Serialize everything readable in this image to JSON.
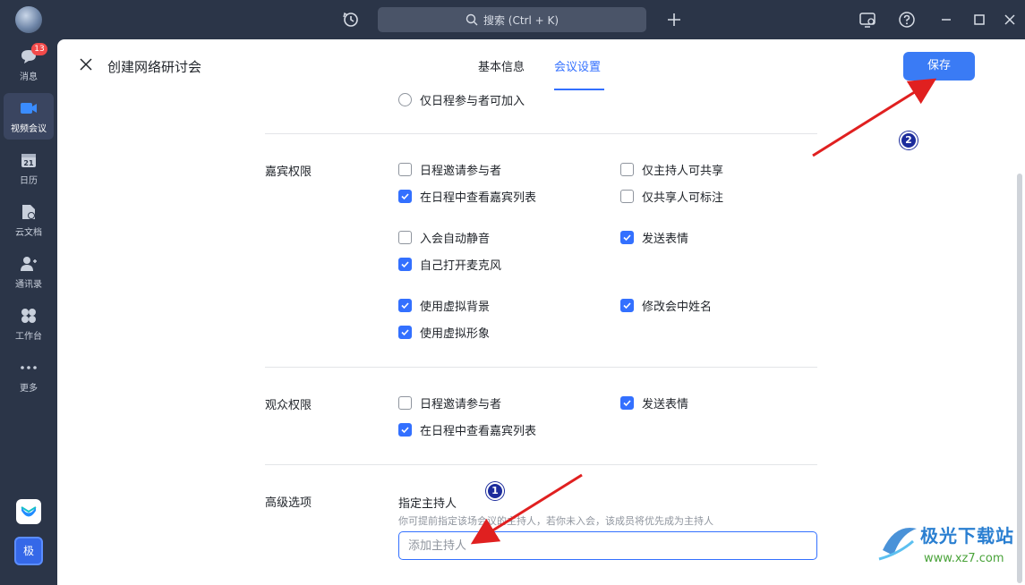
{
  "titlebar": {
    "search_label": "搜索 (Ctrl + K)"
  },
  "sidebar": {
    "items": [
      {
        "label": "消息",
        "icon": "chat-bubble-icon",
        "badge": "13"
      },
      {
        "label": "视频会议",
        "icon": "video-camera-icon"
      },
      {
        "label": "日历",
        "icon": "calendar-icon",
        "icon_text": "21"
      },
      {
        "label": "云文档",
        "icon": "document-icon"
      },
      {
        "label": "通讯录",
        "icon": "contacts-icon"
      },
      {
        "label": "工作台",
        "icon": "grid-icon"
      },
      {
        "label": "更多",
        "icon": "more-dots-icon"
      }
    ],
    "bottom_app_label": "极"
  },
  "panel": {
    "title": "创建网络研讨会",
    "tabs": [
      {
        "label": "基本信息",
        "active": false
      },
      {
        "label": "会议设置",
        "active": true
      }
    ],
    "save_label": "保存",
    "top_radio": "仅日程参与者可加入",
    "sections": {
      "guest": {
        "label": "嘉宾权限",
        "options": [
          {
            "label": "日程邀请参与者",
            "checked": false
          },
          {
            "label": "仅主持人可共享",
            "checked": false
          },
          {
            "label": "在日程中查看嘉宾列表",
            "checked": true
          },
          {
            "label": "仅共享人可标注",
            "checked": false
          },
          {
            "label": "入会自动静音",
            "checked": false
          },
          {
            "label": "发送表情",
            "checked": true
          },
          {
            "label": "自己打开麦克风",
            "checked": true
          },
          {
            "label": "使用虚拟背景",
            "checked": true
          },
          {
            "label": "修改会中姓名",
            "checked": true
          },
          {
            "label": "使用虚拟形象",
            "checked": true
          }
        ]
      },
      "audience": {
        "label": "观众权限",
        "options": [
          {
            "label": "日程邀请参与者",
            "checked": false
          },
          {
            "label": "发送表情",
            "checked": true
          },
          {
            "label": "在日程中查看嘉宾列表",
            "checked": true
          }
        ]
      },
      "advanced": {
        "label": "高级选项",
        "host_label": "指定主持人",
        "host_hint": "你可提前指定该场会议的主持人，若你未入会，该成员将优先成为主持人",
        "host_placeholder": "添加主持人"
      }
    }
  },
  "annotations": {
    "marker1": "1",
    "marker2": "2",
    "arrow_color": "#e02020"
  },
  "watermark": {
    "text1": "极光下载站",
    "text2": "www.xz7.com"
  },
  "colors": {
    "accent": "#3370ff",
    "sidebar_bg": "#2b3548",
    "save_button": "#3a7bf5"
  }
}
